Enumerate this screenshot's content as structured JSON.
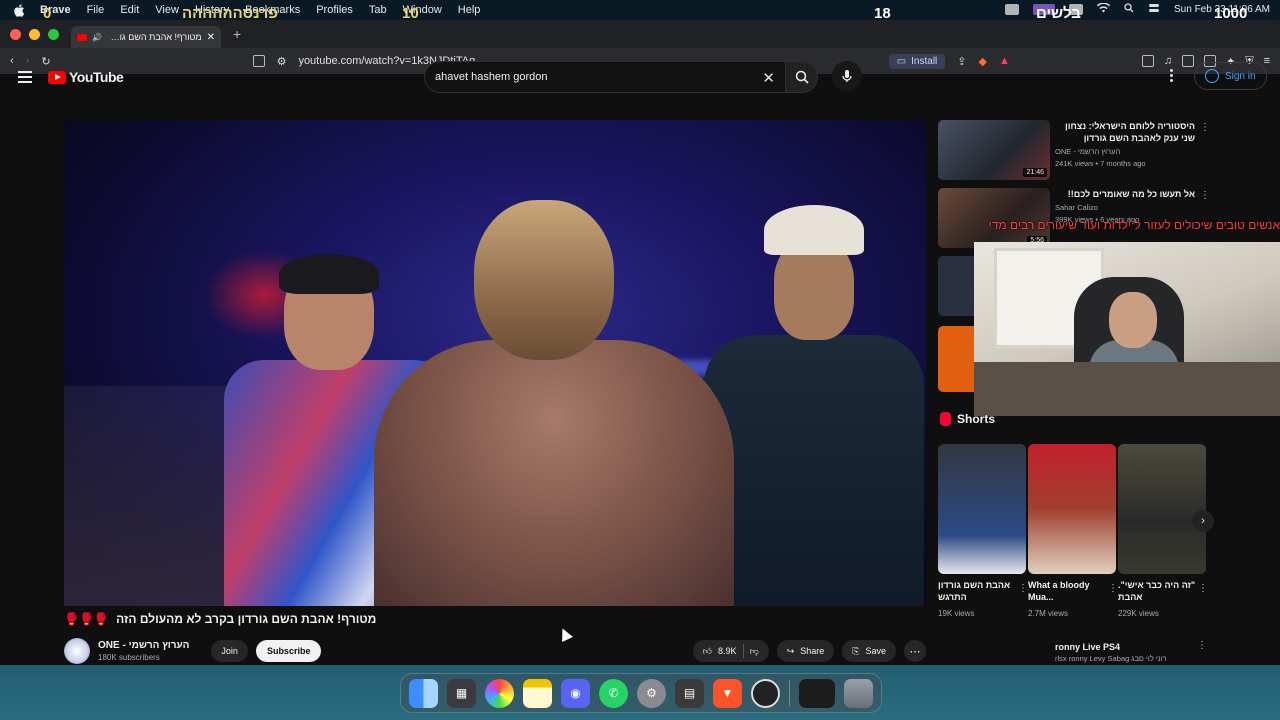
{
  "menubar": {
    "app_name": "Brave",
    "items": [
      "File",
      "Edit",
      "View",
      "History",
      "Bookmarks",
      "Profiles",
      "Tab",
      "Window",
      "Help"
    ],
    "overlay_left": "0",
    "overlay_title": "פרנסהההההה",
    "overlay_ten": "10",
    "overlay_eighteen": "18",
    "overlay_hebrew": "בלשים",
    "overlay_thousand": "1000",
    "clock": "Sun Feb 23  11:06 AM"
  },
  "tab": {
    "title": "מטורף! אהבת השם גורדון בק"
  },
  "toolbar": {
    "url": "youtube.com/watch?v=1k3NJDtjTAg",
    "install_label": "Install"
  },
  "youtube": {
    "logo_text": "YouTube",
    "search_value": "ahavet hashem gordon",
    "signin_label": "Sign in"
  },
  "video": {
    "title": "מטורף! אהבת השם גורדון בקרב לא מהעולם הזה",
    "title_emoji": "🥊🥊🥊",
    "channel_name": "ONE - הערוץ הרשמי",
    "channel_subs": "180K subscribers",
    "join_label": "Join",
    "subscribe_label": "Subscribe",
    "like_count": "8.9K",
    "share_label": "Share",
    "save_label": "Save"
  },
  "recommendations": [
    {
      "title": "היסטוריה ללוחם הישראלי: נצחון שני ענק לאהבת השם גורדון",
      "channel": "ONE - הערוץ הרשמי",
      "meta": "241K views • 7 months ago",
      "duration": "21:46",
      "thumb_color": "#3a4250"
    },
    {
      "title": "אל תעשו כל מה שאומרים לכם!!",
      "channel": "Sahar Calizo",
      "meta": "399K views • 6 years ago",
      "duration": "5:56",
      "thumb_color": "#5a3c2c"
    }
  ],
  "cam_overlay_text": "אנשים טובים שיכולים לעזור ל ילדות ועוד שיעורים רבים מדי",
  "shorts": {
    "header": "Shorts",
    "items": [
      {
        "title": "אהבת השם גורדון התרגש",
        "views": "19K views",
        "color": "#2b4a86"
      },
      {
        "title": "What a bloody Mua...",
        "views": "2.7M views",
        "color": "#c4202a"
      },
      {
        "title": "\"זה היה כבר אישי\". אהבת",
        "views": "229K views",
        "color": "#4d4a3c"
      }
    ]
  },
  "bottom_rec": {
    "title": "ronny Live PS4",
    "meta": "rlsx ronny Levy Sabag רוני לוי סבג"
  },
  "dock": {
    "apps": [
      "finder-icon",
      "launchpad-icon",
      "photos-icon",
      "notes-icon",
      "discord-icon",
      "whatsapp-icon",
      "settings-icon",
      "calculator-icon",
      "brave-icon",
      "obs-icon",
      "screen-icon",
      "trash-icon"
    ]
  }
}
